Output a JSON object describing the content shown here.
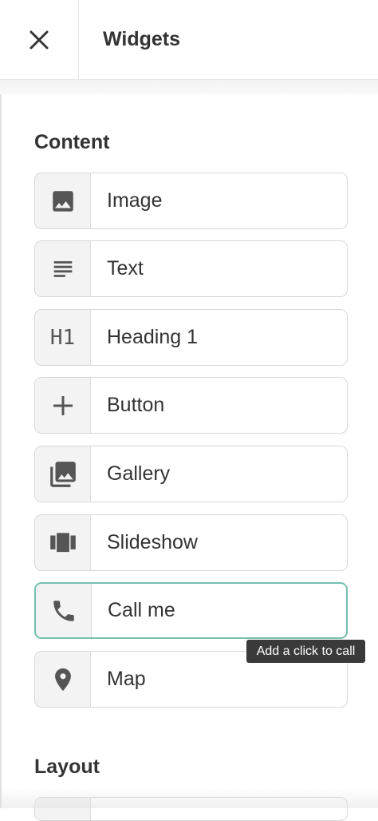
{
  "header": {
    "title": "Widgets",
    "close_icon": "close-icon"
  },
  "sections": {
    "content_title": "Content",
    "layout_title": "Layout"
  },
  "widgets": [
    {
      "label": "Image",
      "icon": "image-icon"
    },
    {
      "label": "Text",
      "icon": "text-lines-icon"
    },
    {
      "label": "Heading 1",
      "icon": "h1-icon",
      "icon_text": "H1"
    },
    {
      "label": "Button",
      "icon": "plus-icon"
    },
    {
      "label": "Gallery",
      "icon": "gallery-icon"
    },
    {
      "label": "Slideshow",
      "icon": "slideshow-icon"
    },
    {
      "label": "Call me",
      "icon": "phone-icon",
      "active": true
    },
    {
      "label": "Map",
      "icon": "map-pin-icon"
    }
  ],
  "tooltip": {
    "text": "Add a click to call"
  },
  "colors": {
    "accent_border": "#73c0ae",
    "icon_fill": "#555555",
    "tooltip_bg": "#3a3a3a"
  }
}
